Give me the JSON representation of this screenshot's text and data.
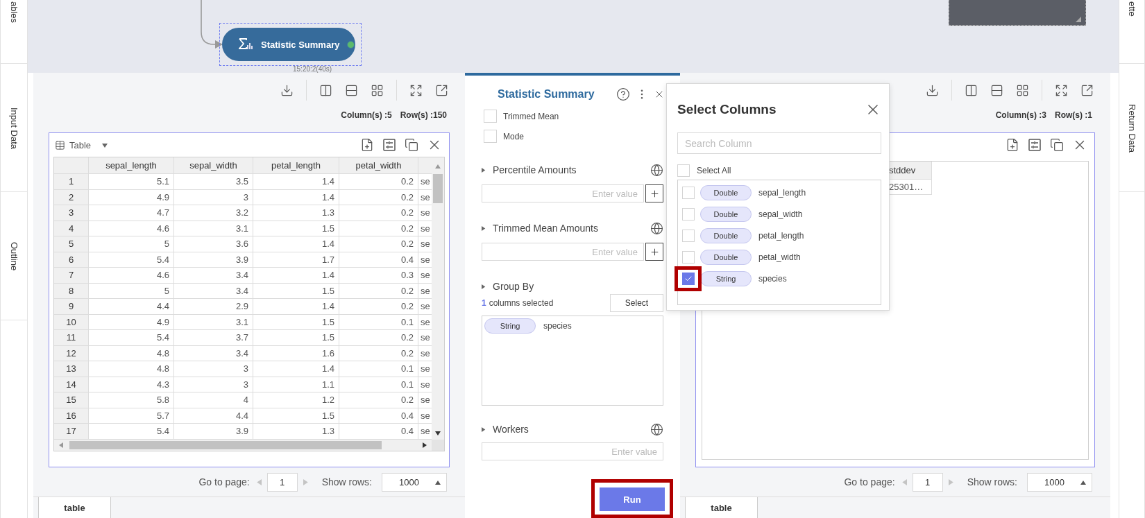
{
  "left_sidebar": {
    "tabs": [
      {
        "label": "ables",
        "selected": false
      },
      {
        "label": "Input Data",
        "selected": false
      },
      {
        "label": "Outline",
        "selected": false
      }
    ]
  },
  "canvas": {
    "node": {
      "label": "Statistic Summary",
      "time": "15:20:2(40s)",
      "selected": true
    }
  },
  "input_panel": {
    "info": [
      "Column(s) :5",
      "Row(s) :150"
    ],
    "table": {
      "title": "Table",
      "columns": [
        "sepal_length",
        "sepal_width",
        "petal_length",
        "petal_width"
      ],
      "rows": [
        [
          "1",
          "5.1",
          "3.5",
          "1.4",
          "0.2",
          "se"
        ],
        [
          "2",
          "4.9",
          "3",
          "1.4",
          "0.2",
          "se"
        ],
        [
          "3",
          "4.7",
          "3.2",
          "1.3",
          "0.2",
          "se"
        ],
        [
          "4",
          "4.6",
          "3.1",
          "1.5",
          "0.2",
          "se"
        ],
        [
          "5",
          "5",
          "3.6",
          "1.4",
          "0.2",
          "se"
        ],
        [
          "6",
          "5.4",
          "3.9",
          "1.7",
          "0.4",
          "se"
        ],
        [
          "7",
          "4.6",
          "3.4",
          "1.4",
          "0.3",
          "se"
        ],
        [
          "8",
          "5",
          "3.4",
          "1.5",
          "0.2",
          "se"
        ],
        [
          "9",
          "4.4",
          "2.9",
          "1.4",
          "0.2",
          "se"
        ],
        [
          "10",
          "4.9",
          "3.1",
          "1.5",
          "0.1",
          "se"
        ],
        [
          "11",
          "5.4",
          "3.7",
          "1.5",
          "0.2",
          "se"
        ],
        [
          "12",
          "4.8",
          "3.4",
          "1.6",
          "0.2",
          "se"
        ],
        [
          "13",
          "4.8",
          "3",
          "1.4",
          "0.1",
          "se"
        ],
        [
          "14",
          "4.3",
          "3",
          "1.1",
          "0.1",
          "se"
        ],
        [
          "15",
          "5.8",
          "4",
          "1.2",
          "0.2",
          "se"
        ],
        [
          "16",
          "5.7",
          "4.4",
          "1.5",
          "0.4",
          "se"
        ],
        [
          "17",
          "5.4",
          "3.9",
          "1.3",
          "0.4",
          "se"
        ]
      ]
    },
    "pagination": {
      "page_label": "Go to page:",
      "page": "1",
      "rows_label": "Show rows:",
      "rows": "1000"
    },
    "tabs": [
      {
        "label": "table",
        "selected": true
      }
    ]
  },
  "settings_panel": {
    "title": "Statistic Summary",
    "options": [
      {
        "label": "Trimmed Mean",
        "checked": false
      },
      {
        "label": "Mode",
        "checked": false
      }
    ],
    "sections": [
      {
        "kind": "amount",
        "title": "Percentile Amounts",
        "placeholder": "Enter value"
      },
      {
        "kind": "amount",
        "title": "Trimmed Mean Amounts",
        "placeholder": "Enter value"
      },
      {
        "kind": "group",
        "title": "Group By",
        "count": "1",
        "count_label": "columns selected",
        "button": "Select",
        "chips": [
          {
            "type": "String",
            "name": "species"
          }
        ]
      },
      {
        "kind": "value",
        "title": "Workers",
        "placeholder": "Enter value"
      }
    ],
    "run": {
      "label": "Run",
      "highlighted": true
    }
  },
  "dialog": {
    "title": "Select Columns",
    "search_placeholder": "Search Column",
    "select_all": {
      "label": "Select All",
      "checked": false
    },
    "columns": [
      {
        "type": "Double",
        "name": "sepal_length",
        "checked": false,
        "highlighted": false
      },
      {
        "type": "Double",
        "name": "sepal_width",
        "checked": false,
        "highlighted": false
      },
      {
        "type": "Double",
        "name": "petal_length",
        "checked": false,
        "highlighted": false
      },
      {
        "type": "Double",
        "name": "petal_width",
        "checked": false,
        "highlighted": false
      },
      {
        "type": "String",
        "name": "species",
        "checked": true,
        "highlighted": true
      }
    ]
  },
  "output_panel": {
    "info": [
      "Column(s) :3",
      "Row(s) :1"
    ],
    "table": {
      "columns": [
        "stddev"
      ],
      "rows": [
        [
          "25301…"
        ]
      ]
    },
    "pagination": {
      "page_label": "Go to page:",
      "page": "1",
      "rows_label": "Show rows:",
      "rows": "1000"
    },
    "tabs": [
      {
        "label": "table",
        "selected": true
      }
    ]
  },
  "right_sidebar": {
    "tabs": [
      {
        "label": "ette",
        "selected": false
      },
      {
        "label": "Return Data",
        "selected": false
      }
    ]
  }
}
